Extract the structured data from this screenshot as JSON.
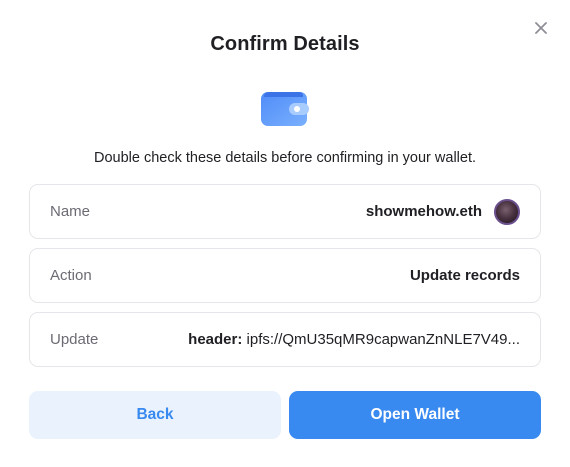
{
  "dialog": {
    "title": "Confirm Details",
    "subtitle": "Double check these details before confirming in your wallet.",
    "icons": {
      "close": "close-icon",
      "wallet": "wallet-icon"
    },
    "rows": {
      "name": {
        "label": "Name",
        "value": "showmehow.eth"
      },
      "action": {
        "label": "Action",
        "value": "Update records"
      },
      "update": {
        "label": "Update",
        "key": "header:",
        "value": "ipfs://QmU35qMR9capwanZnNLE7V49..."
      }
    },
    "buttons": {
      "back": "Back",
      "open": "Open Wallet"
    },
    "colors": {
      "accent": "#3889f0",
      "accent_light": "#eaf2fd",
      "border": "#e6e6ea"
    }
  }
}
